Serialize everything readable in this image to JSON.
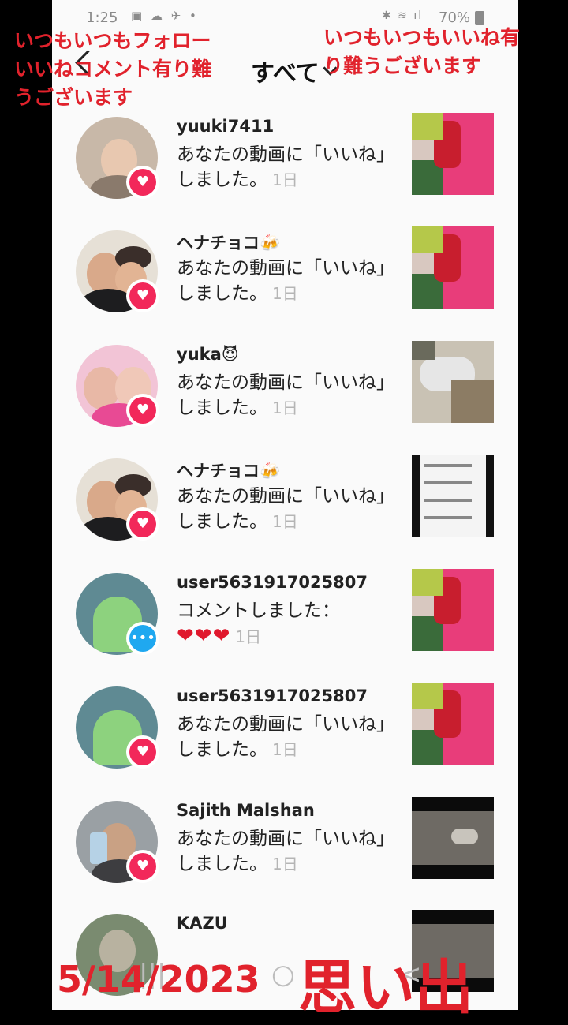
{
  "status_bar": {
    "time": "1:25",
    "left_icons": "▣ ☁ ✈ •",
    "right_icons": "✱ ≋ ıl",
    "battery": "70%"
  },
  "header": {
    "title": "すべて"
  },
  "notifications": [
    {
      "username": "yuuki7411",
      "message": "あなたの動画に「いいね」しました。",
      "ago": "1日",
      "type": "like"
    },
    {
      "username": "ヘナチョコ🍻",
      "message": "あなたの動画に「いいね」しました。",
      "ago": "1日",
      "type": "like"
    },
    {
      "username": "yuka😈",
      "message": "あなたの動画に「いいね」しました。",
      "ago": "1日",
      "type": "like"
    },
    {
      "username": "ヘナチョコ🍻",
      "message": "あなたの動画に「いいね」しました。",
      "ago": "1日",
      "type": "like"
    },
    {
      "username": "user5631917025807",
      "message": "コメントしました：",
      "hearts": "❤❤❤",
      "ago": "1日",
      "type": "comment"
    },
    {
      "username": "user5631917025807",
      "message": "あなたの動画に「いいね」しました。",
      "ago": "1日",
      "type": "like"
    },
    {
      "username": "Sajith Malshan",
      "message": "あなたの動画に「いいね」しました。",
      "ago": "1日",
      "type": "like"
    },
    {
      "username": "KAZU",
      "message": "",
      "ago": "",
      "type": "like"
    }
  ],
  "icons": {
    "like_badge": "heart-icon",
    "comment_badge": "speech-bubble-icon",
    "back": "chevron-left-icon",
    "caret": "chevron-down-icon"
  },
  "nav_bar": {
    "recent": "|||",
    "home": "○",
    "back": "<"
  },
  "overlays": {
    "left_caption": "いつもいつもフォローいいねコメント有り難うございます",
    "right_caption": "いつもいつもいいね有り難うございます",
    "date": "5/14/2023",
    "memory": "思い出"
  },
  "colors": {
    "like": "#f2285a",
    "comment": "#1fa8f0",
    "overlay_text": "#e1222c"
  }
}
